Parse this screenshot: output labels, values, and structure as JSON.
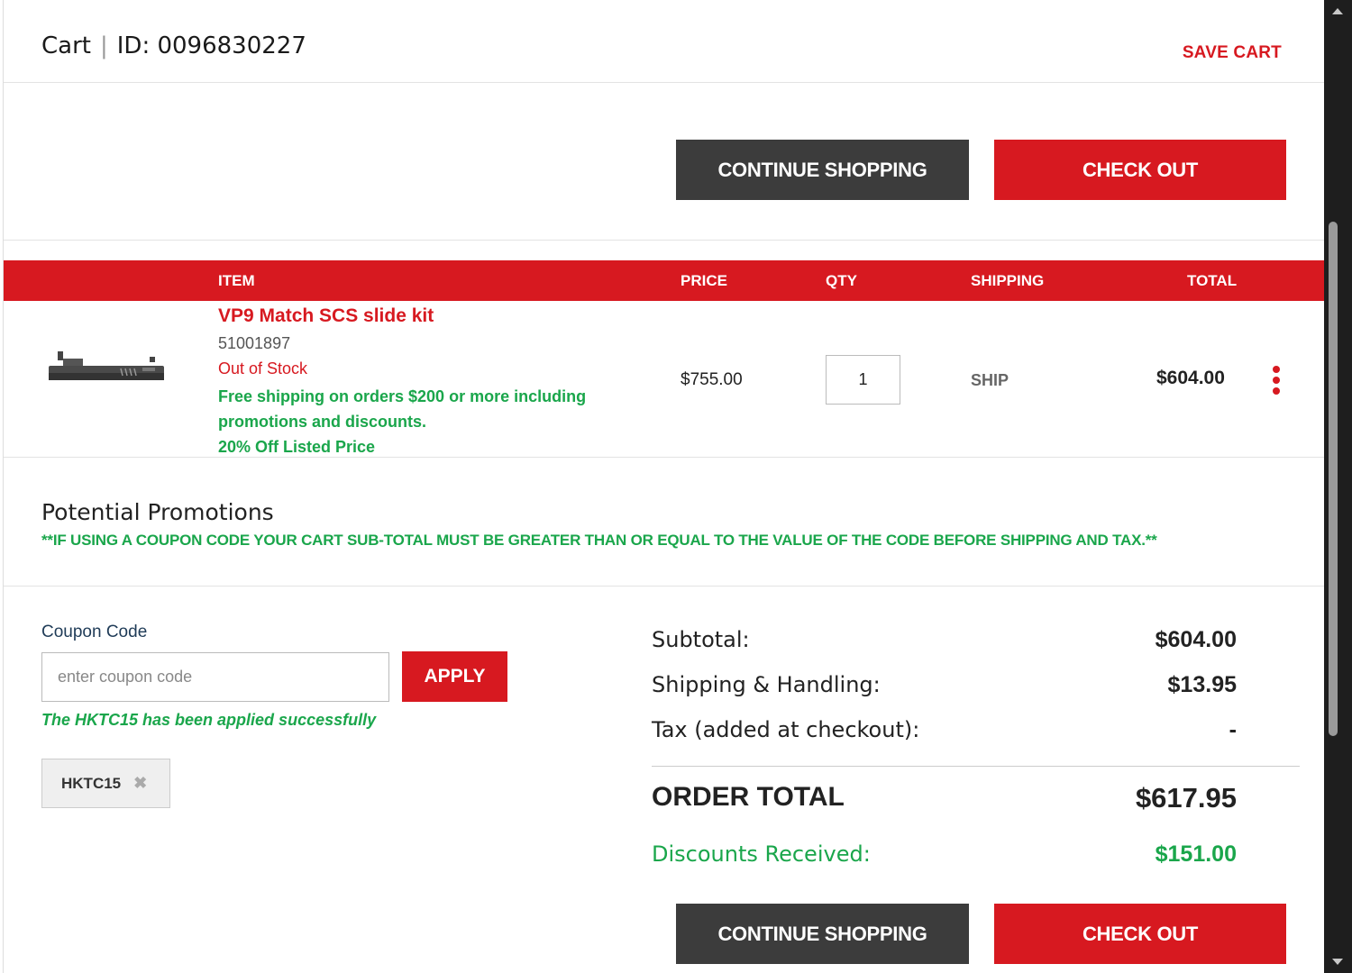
{
  "header": {
    "cart_label": "Cart",
    "separator": "|",
    "cart_id": "ID: 0096830227",
    "save_cart": "SAVE CART"
  },
  "actions": {
    "continue_shopping": "CONTINUE SHOPPING",
    "check_out": "CHECK OUT"
  },
  "table": {
    "headers": {
      "item": "ITEM",
      "price": "PRICE",
      "qty": "QTY",
      "shipping": "SHIPPING",
      "total": "TOTAL"
    },
    "items": [
      {
        "name": "VP9 Match SCS slide kit",
        "sku": "51001897",
        "stock": "Out of Stock",
        "promo_shipping": "Free shipping on orders $200 or more including promotions and discounts.",
        "promo_discount": "20% Off Listed Price",
        "price": "$755.00",
        "qty": "1",
        "shipping": "SHIP",
        "total": "$604.00",
        "image_icon": "slide-kit-product-image",
        "menu_icon": "more-vertical-icon"
      }
    ]
  },
  "promotions": {
    "title": "Potential Promotions",
    "note": "**IF USING A COUPON CODE YOUR CART SUB-TOTAL MUST BE GREATER THAN OR EQUAL TO THE VALUE OF THE CODE BEFORE SHIPPING AND TAX.**"
  },
  "coupon": {
    "label": "Coupon Code",
    "placeholder": "enter coupon code",
    "value": "",
    "apply": "APPLY",
    "success_message": "The HKTC15 has been applied successfully",
    "applied_code": "HKTC15",
    "remove_icon": "✖"
  },
  "summary": {
    "subtotal_label": "Subtotal:",
    "subtotal_value": "$604.00",
    "shipping_label": "Shipping & Handling:",
    "shipping_value": "$13.95",
    "tax_label": "Tax (added at checkout):",
    "tax_value": "-",
    "order_total_label": "ORDER TOTAL",
    "order_total_value": "$617.95",
    "discounts_label": "Discounts Received:",
    "discounts_value": "$151.00"
  },
  "colors": {
    "brand_red": "#d71920",
    "dark_button": "#3c3c3c",
    "success_green": "#1aa64b"
  }
}
